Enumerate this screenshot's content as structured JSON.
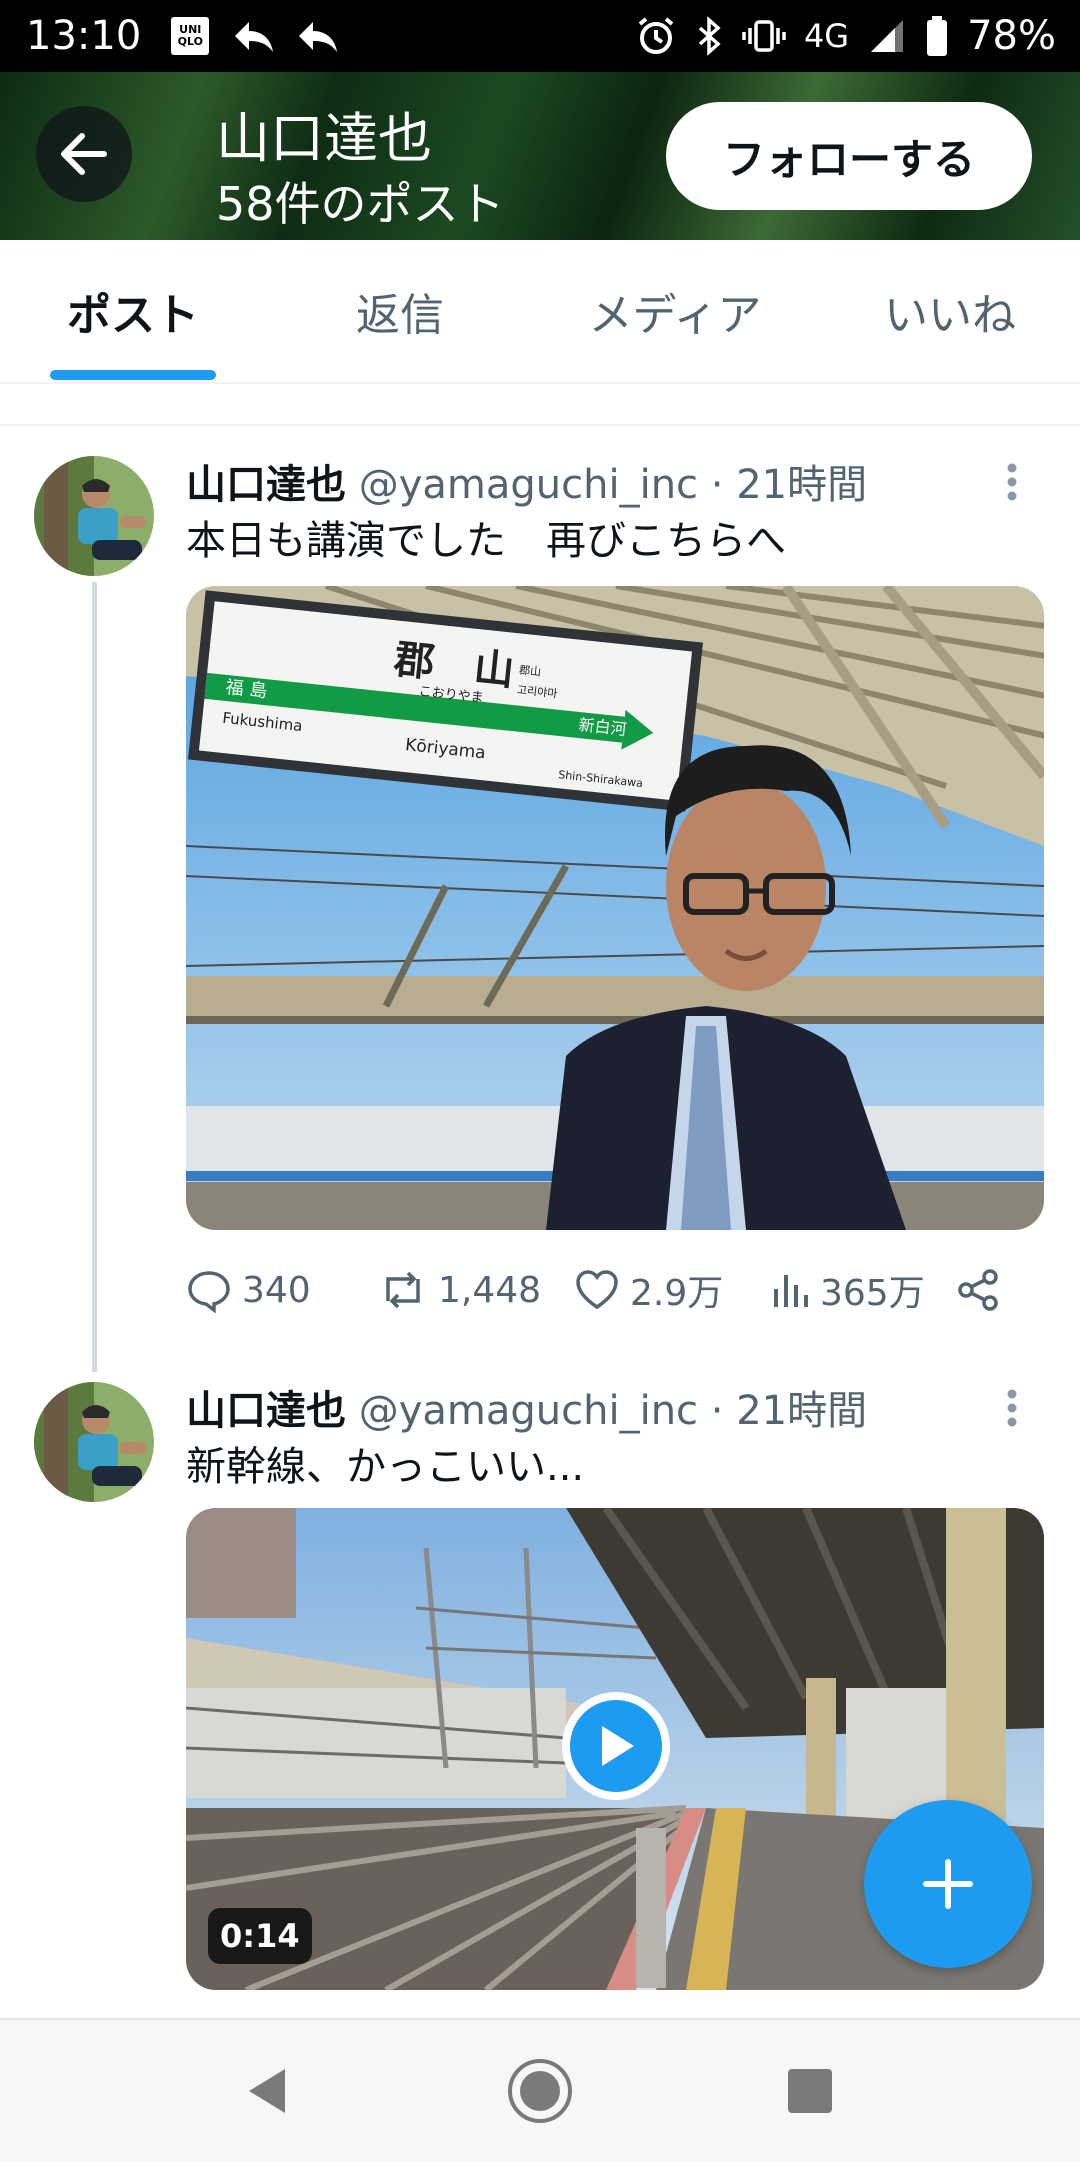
{
  "status_bar": {
    "time": "13:10",
    "network": "4G",
    "battery": "78%",
    "app_logo": "UNIQLO",
    "icons": [
      "uniqlo-icon",
      "reply-arrow-icon",
      "reply-arrow-icon",
      "alarm-icon",
      "bluetooth-icon",
      "vibrate-icon",
      "signal-icon",
      "battery-icon"
    ]
  },
  "header": {
    "name": "山口達也",
    "post_count": "58件のポスト",
    "follow_label": "フォローする",
    "back_icon": "arrow-left-icon"
  },
  "tabs": [
    {
      "label": "ポスト",
      "active": true
    },
    {
      "label": "返信",
      "active": false
    },
    {
      "label": "メディア",
      "active": false
    },
    {
      "label": "いいね",
      "active": false
    }
  ],
  "tweets": [
    {
      "name": "山口達也",
      "handle": "@yamaguchi_inc",
      "time": "· 21時間",
      "text": "本日も講演でした　再びこちらへ",
      "media_type": "photo",
      "sign": {
        "kanji": "郡　山",
        "kana": "こおりやま",
        "korean": "고리야마",
        "romaji": "Kōriyama",
        "left_kanji": "福 島",
        "left_romaji": "Fukushima",
        "right_kanji": "新白河",
        "right_romaji": "Shin-Shirakawa",
        "small_kanji": "郡山"
      },
      "stats": {
        "replies": "340",
        "retweets": "1,448",
        "likes": "2.9万",
        "views": "365万"
      }
    },
    {
      "name": "山口達也",
      "handle": "@yamaguchi_inc",
      "time": "· 21時間",
      "text": "新幹線、かっこいい...",
      "media_type": "video",
      "duration": "0:14"
    }
  ],
  "colors": {
    "accent": "#1d9bf0",
    "text": "#0f1419",
    "secondary": "#536471"
  }
}
